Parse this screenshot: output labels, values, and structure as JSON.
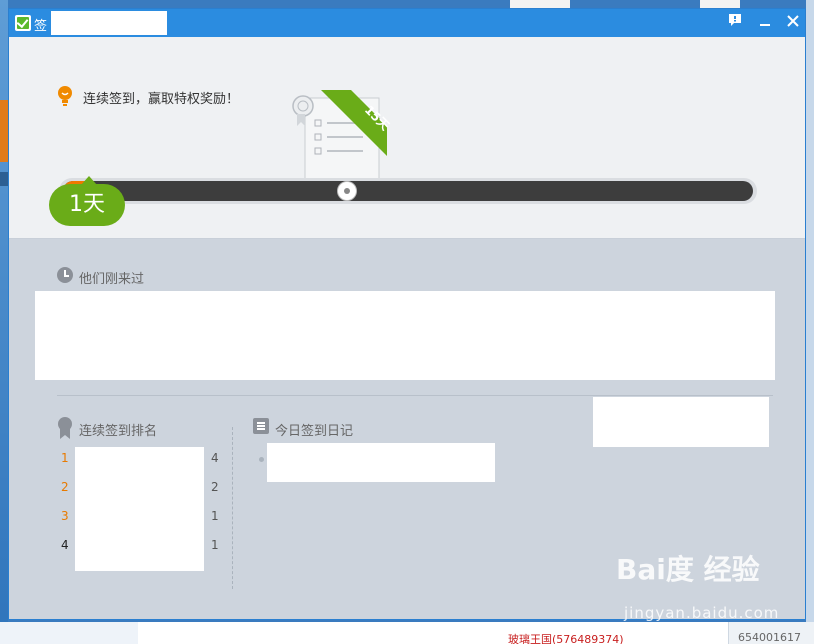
{
  "window": {
    "title": "签",
    "feedback_icon": "feedback-icon",
    "minimize_icon": "minimize-icon",
    "close_icon": "close-icon"
  },
  "header": {
    "promo_text": "连续签到，赢取特权奖励！",
    "badge_label": "15天",
    "progress_fraction": 0.03
  },
  "current_day": "1天",
  "visitors": {
    "label": "他们刚来过"
  },
  "ranking": {
    "label": "连续签到排名",
    "rows": [
      {
        "rank": "1",
        "count": "4",
        "color": "#e87a00"
      },
      {
        "rank": "2",
        "count": "2",
        "color": "#e87a00"
      },
      {
        "rank": "3",
        "count": "1",
        "color": "#e87a00"
      },
      {
        "rank": "4",
        "count": "1",
        "color": "#222222"
      }
    ]
  },
  "diary": {
    "label": "今日签到日记"
  },
  "desktop": {
    "bottom_red_text": "玻璃王国(576489374)",
    "bottom_number": "654001617"
  },
  "watermark": {
    "brand": "Bai度 经验",
    "url": "jingyan.baidu.com"
  },
  "colors": {
    "titlebar": "#2b8ce0",
    "progress_fill": "#f07800",
    "day_bubble": "#6aac18"
  }
}
